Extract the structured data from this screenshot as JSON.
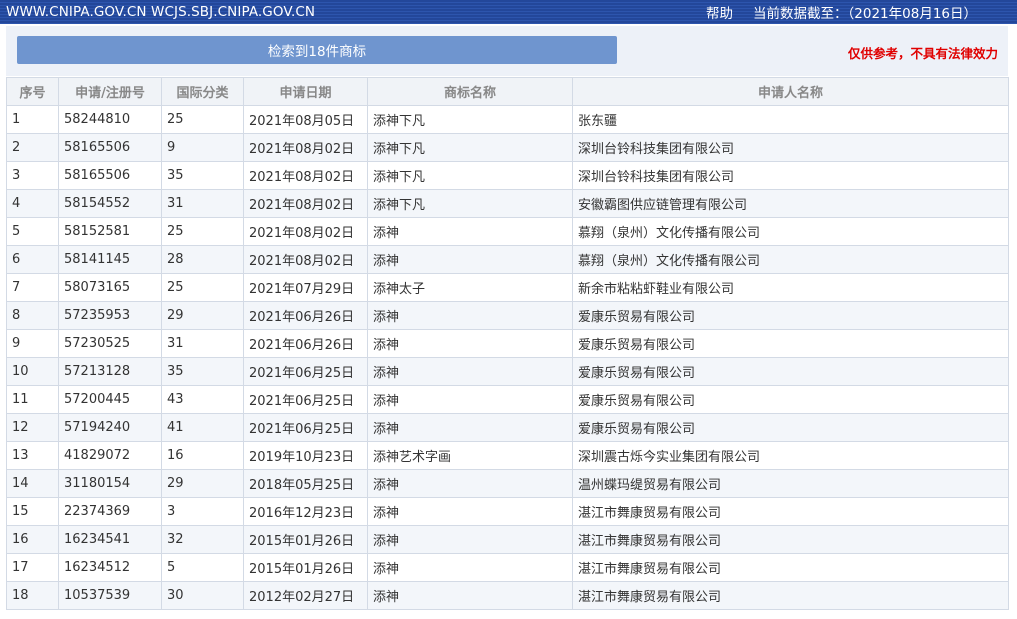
{
  "header": {
    "site": "WWW.CNIPA.GOV.CN WCJS.SBJ.CNIPA.GOV.CN",
    "help": "帮助",
    "data_date": "当前数据截至：（2021年08月16日）"
  },
  "panel": {
    "search_result": "检索到18件商标",
    "disclaimer": "仅供参考，不具有法律效力"
  },
  "table": {
    "columns": [
      "序号",
      "申请/注册号",
      "国际分类",
      "申请日期",
      "商标名称",
      "申请人名称"
    ],
    "rows": [
      [
        "1",
        "58244810",
        "25",
        "2021年08月05日",
        "添神下凡",
        "张东疆"
      ],
      [
        "2",
        "58165506",
        "9",
        "2021年08月02日",
        "添神下凡",
        "深圳台铃科技集团有限公司"
      ],
      [
        "3",
        "58165506",
        "35",
        "2021年08月02日",
        "添神下凡",
        "深圳台铃科技集团有限公司"
      ],
      [
        "4",
        "58154552",
        "31",
        "2021年08月02日",
        "添神下凡",
        "安徽霸图供应链管理有限公司"
      ],
      [
        "5",
        "58152581",
        "25",
        "2021年08月02日",
        "添神",
        "慕翔（泉州）文化传播有限公司"
      ],
      [
        "6",
        "58141145",
        "28",
        "2021年08月02日",
        "添神",
        "慕翔（泉州）文化传播有限公司"
      ],
      [
        "7",
        "58073165",
        "25",
        "2021年07月29日",
        "添神太子",
        "新余市粘粘虾鞋业有限公司"
      ],
      [
        "8",
        "57235953",
        "29",
        "2021年06月26日",
        "添神",
        "爱康乐贸易有限公司"
      ],
      [
        "9",
        "57230525",
        "31",
        "2021年06月26日",
        "添神",
        "爱康乐贸易有限公司"
      ],
      [
        "10",
        "57213128",
        "35",
        "2021年06月25日",
        "添神",
        "爱康乐贸易有限公司"
      ],
      [
        "11",
        "57200445",
        "43",
        "2021年06月25日",
        "添神",
        "爱康乐贸易有限公司"
      ],
      [
        "12",
        "57194240",
        "41",
        "2021年06月25日",
        "添神",
        "爱康乐贸易有限公司"
      ],
      [
        "13",
        "41829072",
        "16",
        "2019年10月23日",
        "添神艺术字画",
        "深圳震古烁今实业集团有限公司"
      ],
      [
        "14",
        "31180154",
        "29",
        "2018年05月25日",
        "添神",
        "温州蝶玛缇贸易有限公司"
      ],
      [
        "15",
        "22374369",
        "3",
        "2016年12月23日",
        "添神",
        "湛江市舞康贸易有限公司"
      ],
      [
        "16",
        "16234541",
        "32",
        "2015年01月26日",
        "添神",
        "湛江市舞康贸易有限公司"
      ],
      [
        "17",
        "16234512",
        "5",
        "2015年01月26日",
        "添神",
        "湛江市舞康贸易有限公司"
      ],
      [
        "18",
        "10537539",
        "30",
        "2012年02月27日",
        "添神",
        "湛江市舞康贸易有限公司"
      ]
    ]
  },
  "colors": {
    "header_bg": "#2a50a8",
    "button_bg": "#6f95cf",
    "link": "#2a7fc1",
    "disclaimer": "#e00000"
  }
}
